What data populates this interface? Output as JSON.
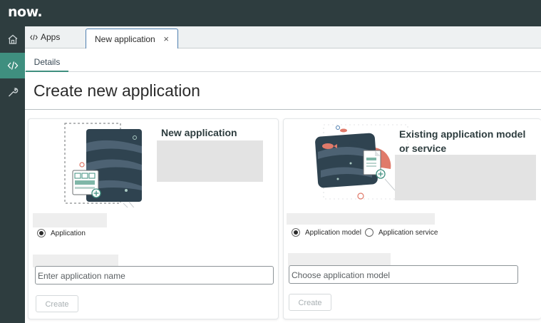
{
  "topbar": {
    "logo": "now.",
    "logo_icon": "now-logo"
  },
  "rail": {
    "items": [
      "home-icon",
      "code-icon",
      "wrench-icon"
    ]
  },
  "tabs": {
    "apps_label": "Apps",
    "app_tab_label": "New application",
    "close_glyph": "×"
  },
  "subtabs": {
    "details": "Details"
  },
  "page": {
    "title": "Create new application"
  },
  "new_app": {
    "heading": "New application",
    "radio_application": "Application",
    "input_placeholder": "Enter application name",
    "create_label": "Create"
  },
  "existing": {
    "heading_line1": "Existing application model",
    "heading_line2": "or service",
    "radio_model": "Application model",
    "radio_service": "Application service",
    "input_placeholder": "Choose application model",
    "create_label": "Create"
  },
  "colors": {
    "topbar": "#2e3d3f",
    "accent": "#3f8f7f",
    "tab_border": "#4e7fb0",
    "salmon": "#e07a6a",
    "card_dark": "#2f4350"
  }
}
